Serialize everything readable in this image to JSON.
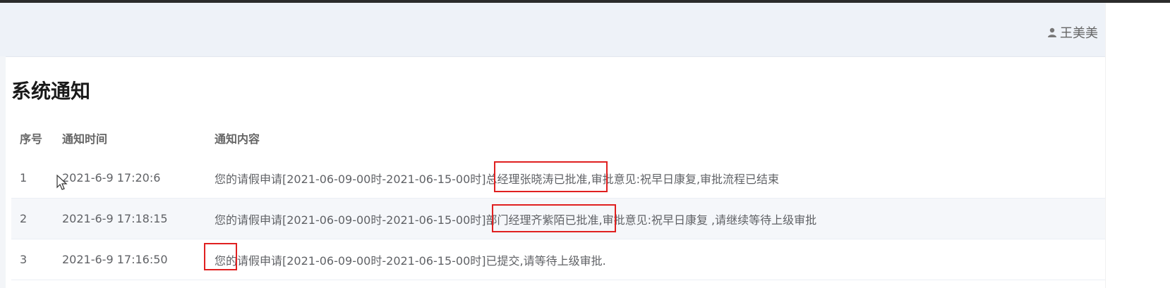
{
  "header": {
    "user_name": "王美美"
  },
  "page": {
    "title": "系统通知"
  },
  "table": {
    "headers": [
      "序号",
      "通知时间",
      "通知内容"
    ],
    "rows": [
      {
        "index": "1",
        "time": "2021-6-9 17:20:6",
        "content": "您的请假申请[2021-06-09-00时-2021-06-15-00时]总经理张晓涛已批准,审批意见:祝早日康复,审批流程已结束"
      },
      {
        "index": "2",
        "time": "2021-6-9 17:18:15",
        "content": "您的请假申请[2021-06-09-00时-2021-06-15-00时]部门经理齐紫陌已批准,审批意见:祝早日康复 ,请继续等待上级审批"
      },
      {
        "index": "3",
        "time": "2021-6-9 17:16:50",
        "content": "您的请假申请[2021-06-09-00时-2021-06-15-00时]已提交,请等待上级审批."
      }
    ]
  },
  "colors": {
    "highlight": "#e02020",
    "header_bg": "#eef2f8",
    "stripe": "#f5f7fa"
  },
  "icons": {
    "user": "user-icon",
    "cursor": "mouse-cursor-icon"
  }
}
